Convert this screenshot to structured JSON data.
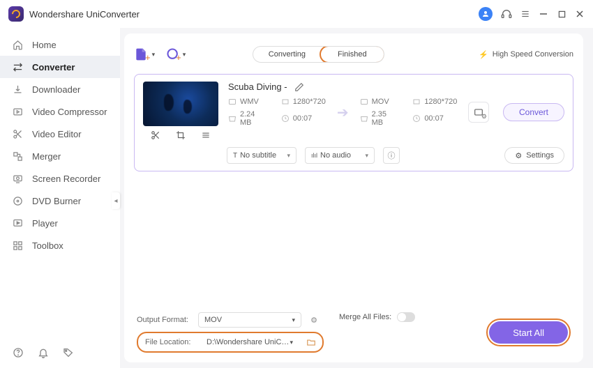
{
  "app_title": "Wondershare UniConverter",
  "sidebar": {
    "items": [
      {
        "label": "Home"
      },
      {
        "label": "Converter"
      },
      {
        "label": "Downloader"
      },
      {
        "label": "Video Compressor"
      },
      {
        "label": "Video Editor"
      },
      {
        "label": "Merger"
      },
      {
        "label": "Screen Recorder"
      },
      {
        "label": "DVD Burner"
      },
      {
        "label": "Player"
      },
      {
        "label": "Toolbox"
      }
    ]
  },
  "tabs": {
    "converting": "Converting",
    "finished": "Finished"
  },
  "high_speed": "High Speed Conversion",
  "file": {
    "name": "Scuba Diving -",
    "src": {
      "format": "WMV",
      "res": "1280*720",
      "size": "2.24 MB",
      "dur": "00:07"
    },
    "dst": {
      "format": "MOV",
      "res": "1280*720",
      "size": "2.35 MB",
      "dur": "00:07"
    },
    "subtitle": "No subtitle",
    "audio": "No audio",
    "settings": "Settings",
    "convert": "Convert"
  },
  "bottom": {
    "output_format_label": "Output Format:",
    "output_format": "MOV",
    "file_location_label": "File Location:",
    "file_location": "D:\\Wondershare UniConverter",
    "merge_label": "Merge All Files:",
    "start_all": "Start All"
  }
}
